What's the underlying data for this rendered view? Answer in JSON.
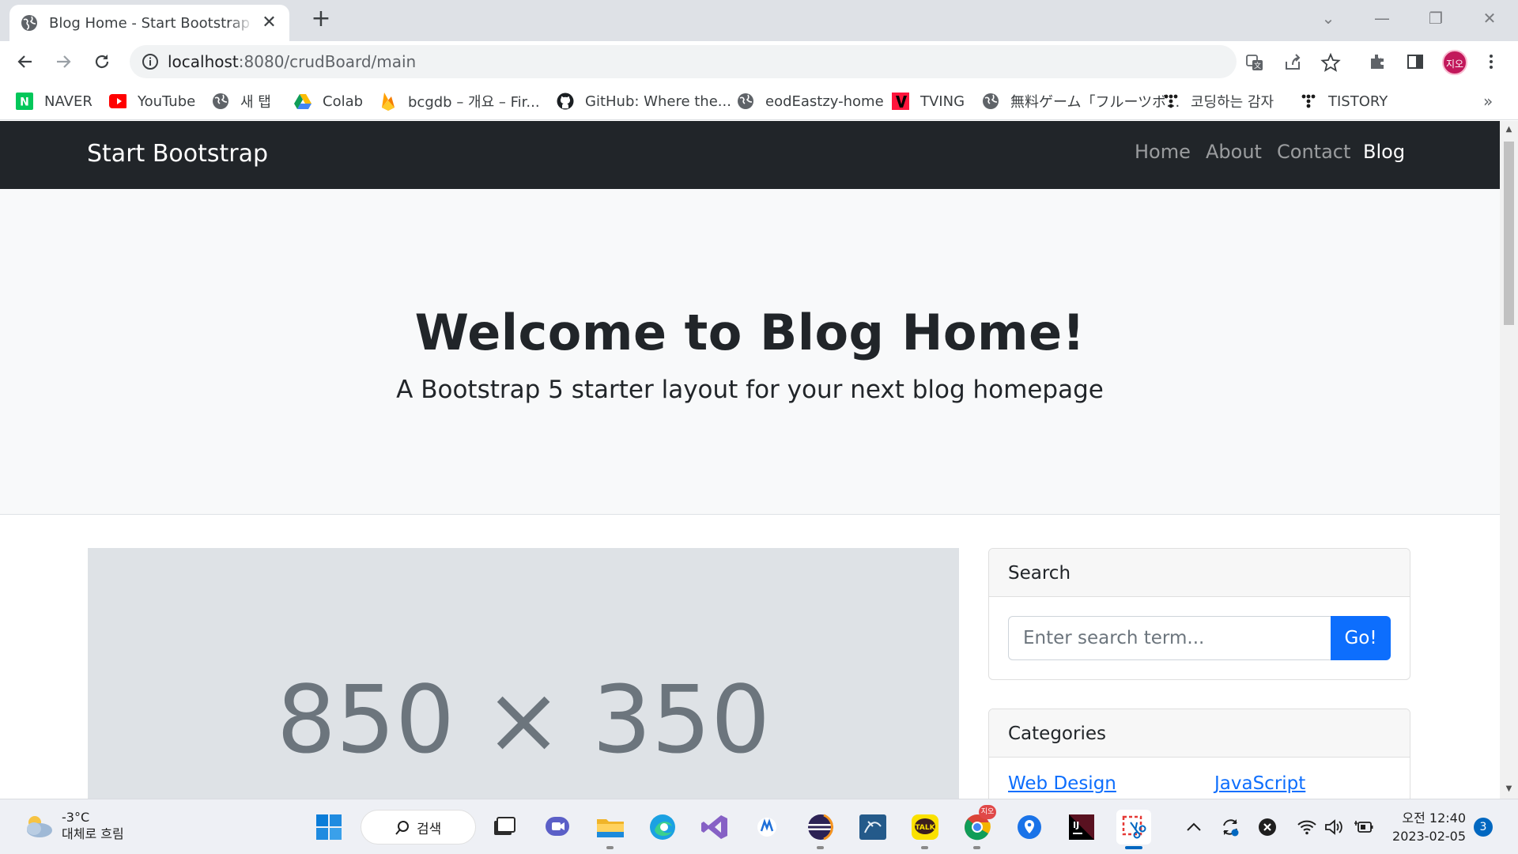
{
  "browser": {
    "tab_title": "Blog Home - Start Bootstrap Template",
    "url_host": "localhost",
    "url_rest": ":8080/crudBoard/main",
    "profile_label": "지오",
    "bookmarks": [
      {
        "label": "NAVER",
        "icon": "naver-icon"
      },
      {
        "label": "YouTube",
        "icon": "youtube-icon"
      },
      {
        "label": "새 탭",
        "icon": "globe-icon"
      },
      {
        "label": "Colab",
        "icon": "google-drive-icon"
      },
      {
        "label": "bcgdb – 개요 – Fir...",
        "icon": "firebase-icon"
      },
      {
        "label": "GitHub: Where the...",
        "icon": "github-icon"
      },
      {
        "label": "eodEastzy-home",
        "icon": "globe-icon"
      },
      {
        "label": "TVING",
        "icon": "tving-icon"
      },
      {
        "label": "無料ゲーム「フルーツボ...",
        "icon": "globe-icon"
      },
      {
        "label": "코딩하는 감자",
        "icon": "tistory-icon"
      },
      {
        "label": "TISTORY",
        "icon": "tistory-icon"
      }
    ],
    "more_bookmarks": "»"
  },
  "page": {
    "brand": "Start Bootstrap",
    "nav": [
      "Home",
      "About",
      "Contact",
      "Blog"
    ],
    "active_nav": "Blog",
    "hero_title": "Welcome to Blog Home!",
    "hero_subtitle": "A Bootstrap 5 starter layout for your next blog homepage",
    "placeholder_image_text": "850 × 350",
    "search": {
      "header": "Search",
      "placeholder": "Enter search term...",
      "button": "Go!"
    },
    "categories": {
      "header": "Categories",
      "links": [
        "Web Design",
        "JavaScript"
      ]
    }
  },
  "taskbar": {
    "weather_temp": "-3°C",
    "weather_desc": "대체로 흐림",
    "search_label": "검색",
    "clock_time": "오전 12:40",
    "clock_date": "2023-02-05",
    "notification_count": "3",
    "chrome_badge": "지오"
  },
  "colors": {
    "navbar_bg": "#212529",
    "hero_bg": "#f8f9fa",
    "primary": "#0d6efd"
  }
}
